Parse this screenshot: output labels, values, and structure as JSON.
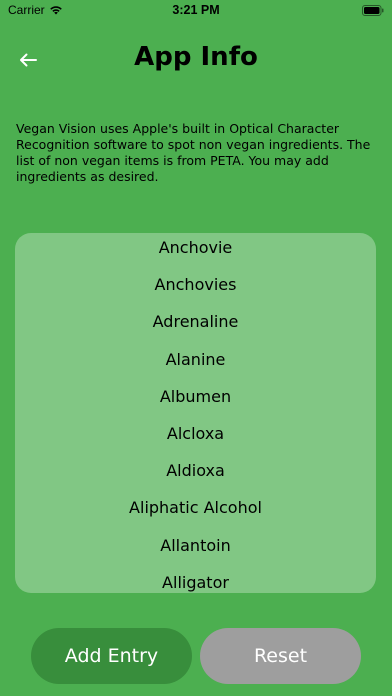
{
  "status_bar": {
    "carrier": "Carrier",
    "time": "3:21 PM"
  },
  "header": {
    "title": "App Info",
    "back_icon": "arrow-left-icon"
  },
  "description": "Vegan Vision uses Apple's built in Optical Character Recognition software to spot non vegan ingredients. The list of non vegan items is from PETA. You may add ingredients as desired.",
  "ingredients": [
    "Anchovie",
    "Anchovies",
    "Adrenaline",
    "Alanine",
    "Albumen",
    "Alcloxa",
    "Aldioxa",
    "Aliphatic Alcohol",
    "Allantoin",
    "Alligator"
  ],
  "buttons": {
    "add_label": "Add Entry",
    "reset_label": "Reset"
  },
  "colors": {
    "background": "#4caf50",
    "list_background": "#81c784",
    "add_button": "#388e3c",
    "reset_button": "#9e9e9e"
  }
}
